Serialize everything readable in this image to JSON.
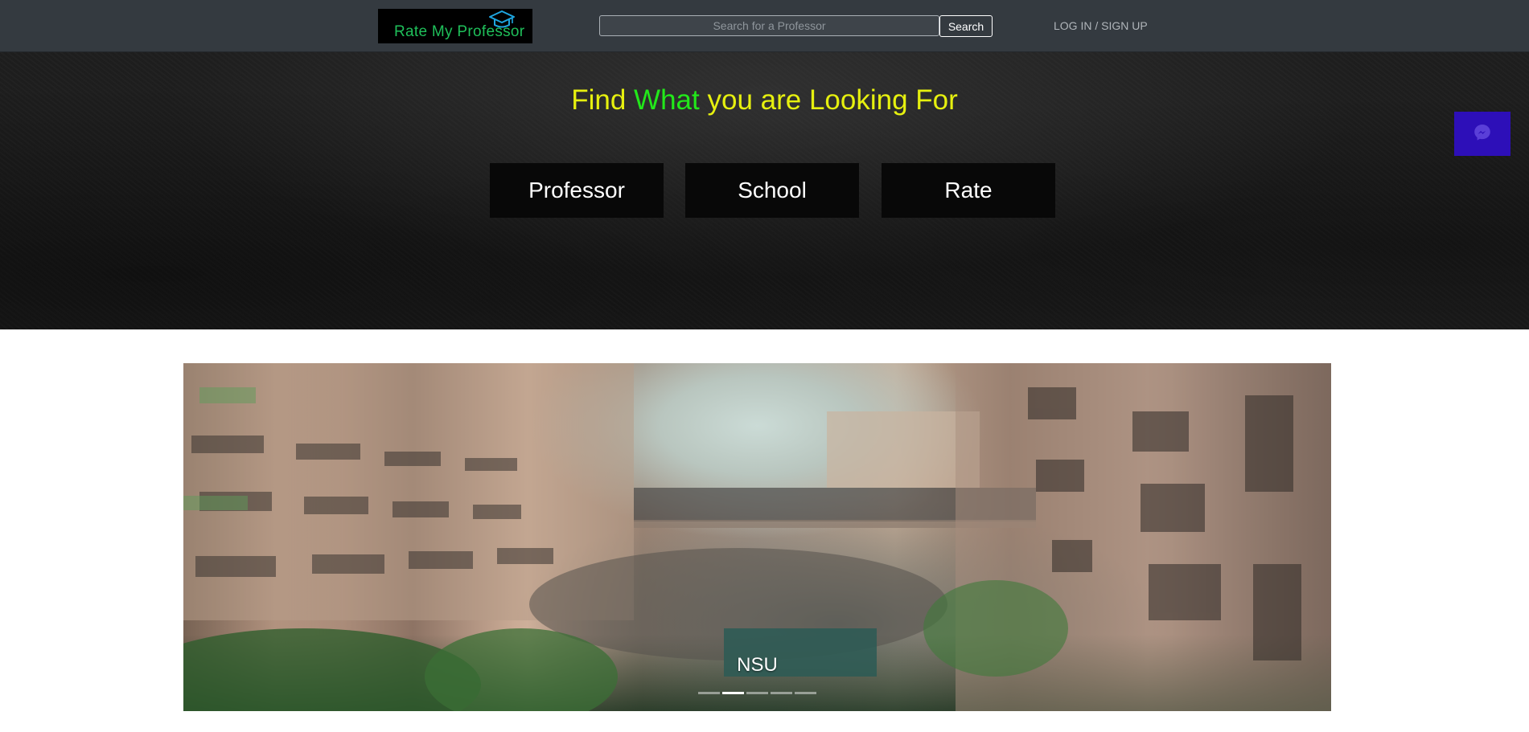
{
  "navbar": {
    "logo_text": "Rate My Professor",
    "search_placeholder": "Search for a Professor",
    "search_button_label": "Search",
    "login_label": "LOG IN / SIGN UP"
  },
  "hero": {
    "heading_part1": "Find ",
    "heading_highlight": "What",
    "heading_part2": " you are Looking For",
    "buttons": [
      {
        "label": "Professor"
      },
      {
        "label": "School"
      },
      {
        "label": "Rate"
      }
    ]
  },
  "messenger": {
    "icon": "messenger-icon"
  },
  "carousel": {
    "caption": "NSU",
    "slide_count": 5,
    "active_index": 1
  },
  "colors": {
    "navbar_bg": "#343a40",
    "heading_yellow": "#e6f00f",
    "heading_green": "#22e81a",
    "logo_green": "#1fbf5a",
    "logo_cap_blue": "#1ea6e0",
    "messenger_bg": "#2d0fb8"
  }
}
